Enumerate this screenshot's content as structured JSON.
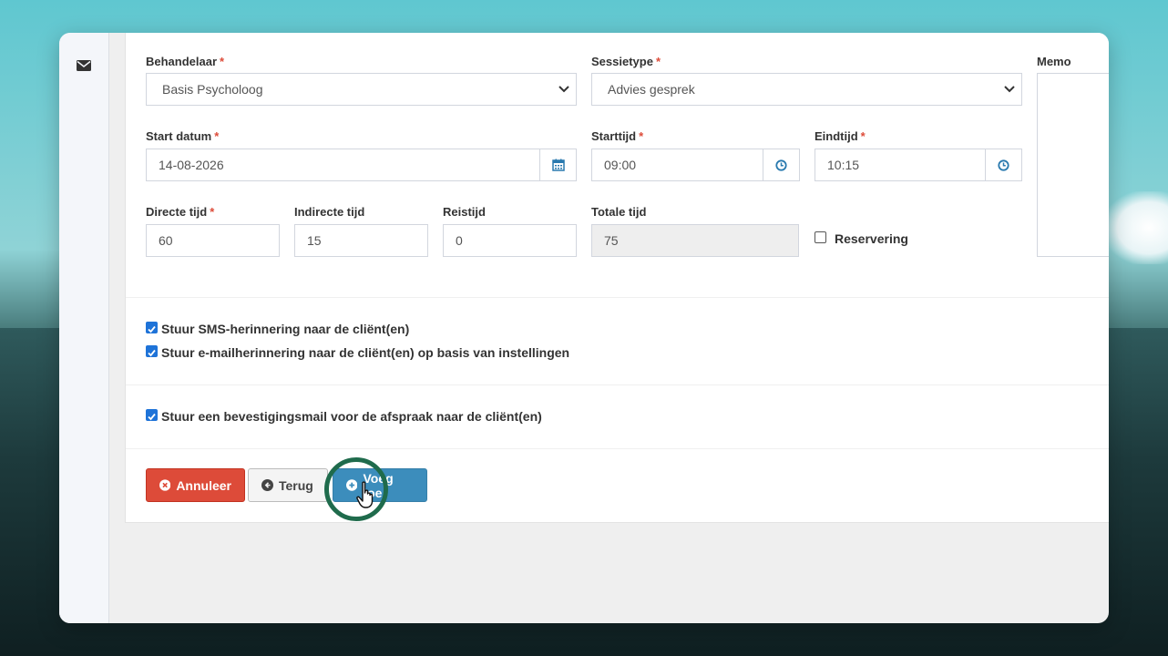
{
  "form": {
    "behandelaar": {
      "label": "Behandelaar",
      "value": "Basis Psycholoog"
    },
    "sessietype": {
      "label": "Sessietype",
      "value": "Advies gesprek"
    },
    "memo": {
      "label": "Memo"
    },
    "start_datum": {
      "label": "Start datum",
      "value": "14-08-2026"
    },
    "starttijd": {
      "label": "Starttijd",
      "value": "09:00"
    },
    "eindtijd": {
      "label": "Eindtijd",
      "value": "10:15"
    },
    "directe_tijd": {
      "label": "Directe tijd",
      "value": "60"
    },
    "indirecte_tijd": {
      "label": "Indirecte tijd",
      "value": "15"
    },
    "reistijd": {
      "label": "Reistijd",
      "value": "0"
    },
    "totale_tijd": {
      "label": "Totale tijd",
      "value": "75"
    },
    "reservering": {
      "label": "Reservering"
    },
    "required_marker": "*"
  },
  "options": {
    "sms": "Stuur SMS-herinnering naar de cliënt(en)",
    "email": "Stuur e-mailherinnering naar de cliënt(en) op basis van instellingen",
    "bevestiging": "Stuur een bevestigingsmail voor de afspraak naar de cliënt(en)"
  },
  "buttons": {
    "annuleer": "Annuleer",
    "terug": "Terug",
    "voeg_toe": "Voeg toe"
  },
  "colors": {
    "danger": "#dd4b39",
    "primary": "#3c8dbc",
    "checkbox": "#1e73d8",
    "icon_blue": "#2a7aaf",
    "cursor_ring": "#1f6b4c"
  }
}
